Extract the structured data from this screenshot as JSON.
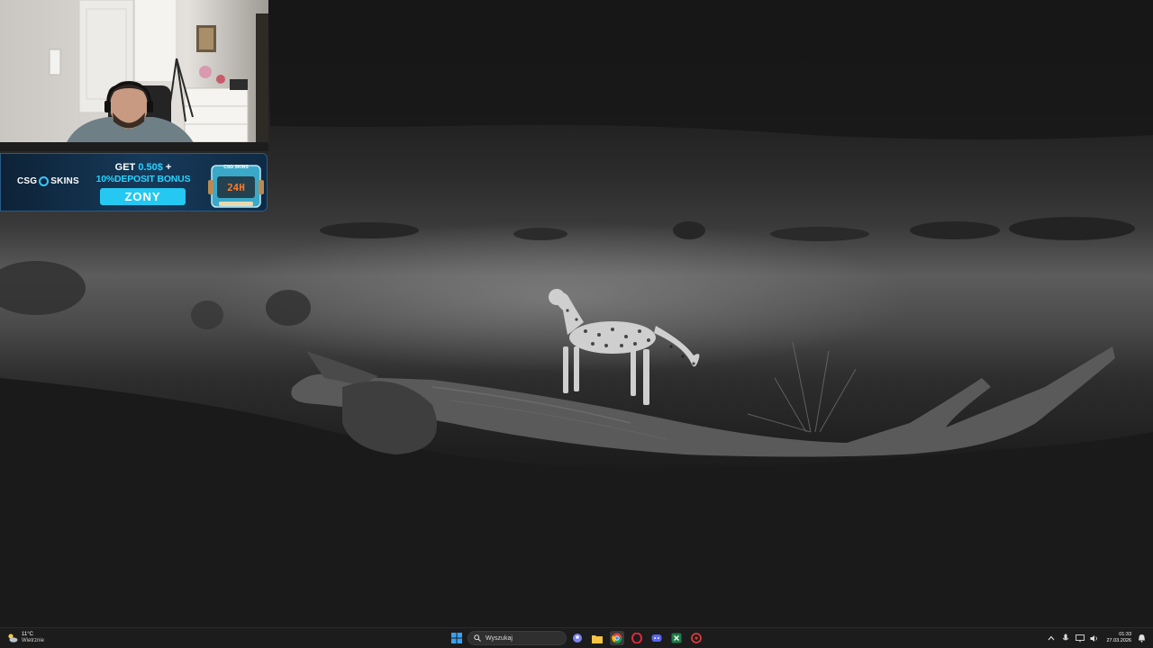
{
  "banner": {
    "brand_prefix": "CSG",
    "brand_suffix": "SKINS",
    "line1_prefix": "GET ",
    "line1_amount": "0.50$",
    "line1_suffix": " +",
    "line2": "10%DEPOSIT BONUS",
    "promo_code": "ZONY",
    "box_label": "24H",
    "box_brand": "CSG SKINS"
  },
  "taskbar": {
    "weather": {
      "temperature": "11°C",
      "condition": "Wietrznie",
      "icon": "partly-cloudy-icon"
    },
    "search_placeholder": "Wyszukaj",
    "pinned_apps": [
      {
        "name": "start-button",
        "icon": "windows-logo-icon",
        "color": "#2b8de6"
      },
      {
        "name": "teams",
        "icon": "teams-icon",
        "color": "#7b83eb"
      },
      {
        "name": "file-explorer",
        "icon": "folder-icon",
        "color": "#f6c343"
      },
      {
        "name": "chrome",
        "icon": "chrome-icon",
        "color": "#4caf50"
      },
      {
        "name": "opera",
        "icon": "opera-icon",
        "color": "#e0283b"
      },
      {
        "name": "discord",
        "icon": "discord-icon",
        "color": "#5865f2"
      },
      {
        "name": "excel",
        "icon": "excel-icon",
        "color": "#1f7a47"
      },
      {
        "name": "app",
        "icon": "app-icon",
        "color": "#d83b3b"
      }
    ],
    "clock": {
      "time": "01:33",
      "date": "27.03.2026"
    }
  },
  "desktop": {
    "wallpaper": "cheetah-on-log-monochrome"
  }
}
